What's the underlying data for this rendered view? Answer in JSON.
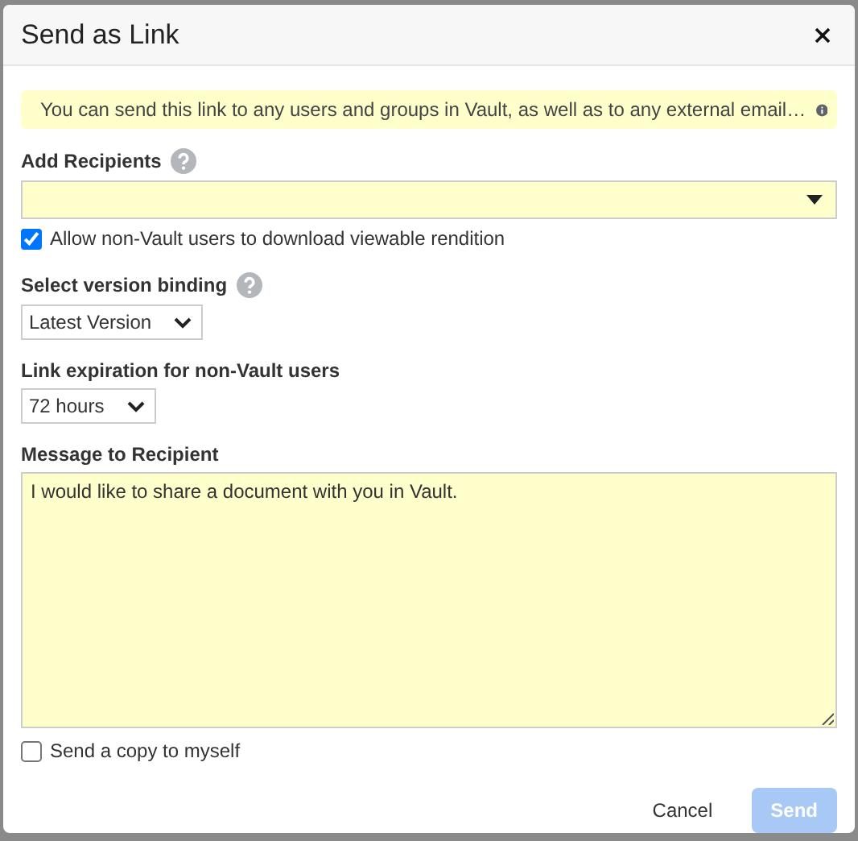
{
  "dialog": {
    "title": "Send as Link"
  },
  "notice": {
    "text": "You can send this link to any users and groups in Vault, as well as to any external email…"
  },
  "recipients": {
    "label": "Add Recipients",
    "help": true
  },
  "allow_download": {
    "label": "Allow non-Vault users to download viewable rendition",
    "checked": true
  },
  "version_binding": {
    "label": "Select version binding",
    "help": true,
    "value": "Latest Version"
  },
  "link_expiration": {
    "label": "Link expiration for non-Vault users",
    "help": false,
    "value": "72 hours"
  },
  "message": {
    "label": "Message to Recipient",
    "value": "I would like to share a document with you in Vault."
  },
  "send_copy": {
    "label": "Send a copy to myself",
    "checked": false
  },
  "buttons": [
    {
      "label": "Cancel",
      "kind": "link",
      "disabled": false
    },
    {
      "label": "Send",
      "kind": "primary",
      "disabled": true
    }
  ]
}
